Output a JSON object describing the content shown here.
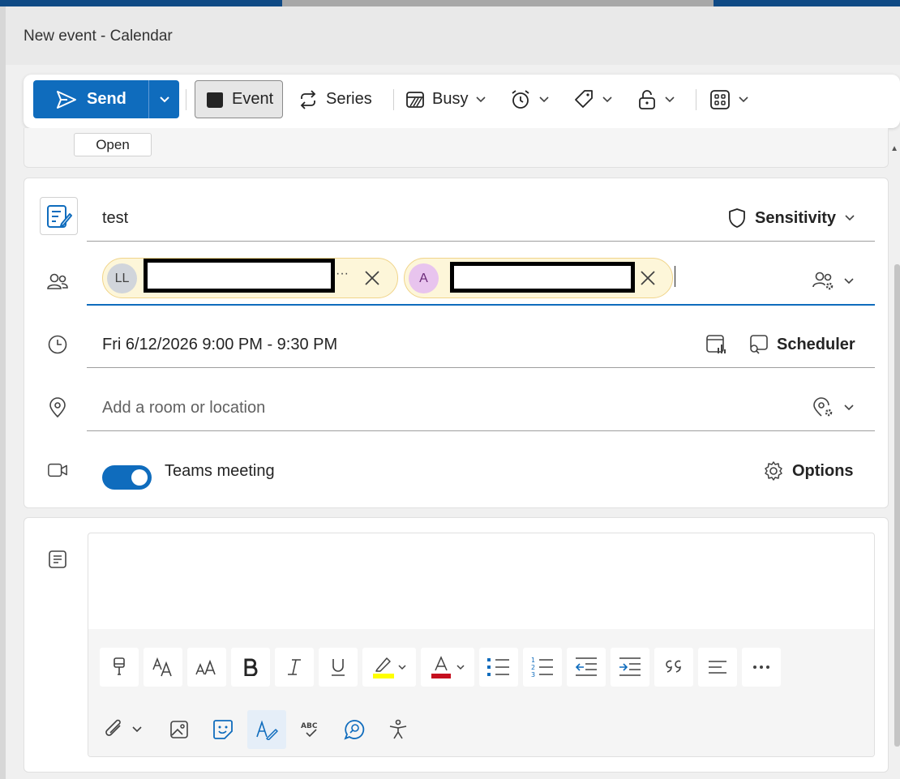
{
  "window": {
    "title": "New event - Calendar"
  },
  "toolbar": {
    "send_label": "Send",
    "event_label": "Event",
    "series_label": "Series",
    "busy_label": "Busy"
  },
  "infobar": {
    "open_label": "Open"
  },
  "event": {
    "title": "test",
    "sensitivity_label": "Sensitivity",
    "attendees": [
      {
        "initials": "LL",
        "avatar_color": "#d1d5db",
        "initials_color": "#424242"
      },
      {
        "initials": "A",
        "avatar_color": "#e8c4ee",
        "initials_color": "#6b2a78"
      }
    ],
    "time": "Fri 6/12/2026 9:00 PM - 9:30 PM",
    "scheduler_label": "Scheduler",
    "location_placeholder": "Add a room or location",
    "teams_label": "Teams meeting",
    "teams_enabled": true,
    "options_label": "Options",
    "overflow_glyph": "···"
  },
  "colors": {
    "accent": "#0f6cbd",
    "highlight": "#ffff00",
    "font_color": "#c50f1f"
  }
}
